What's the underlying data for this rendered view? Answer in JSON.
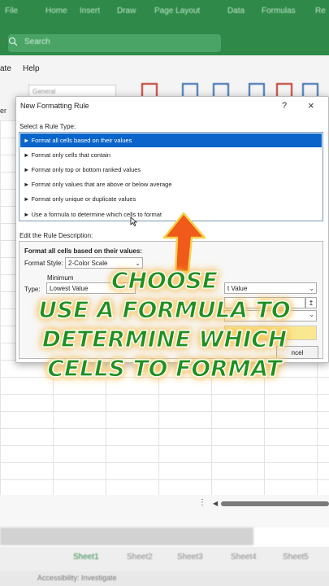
{
  "ribbon": {
    "tabs": [
      "File",
      "Home",
      "Insert",
      "Draw",
      "Page Layout",
      "Data",
      "Formulas",
      "Re"
    ],
    "search_placeholder": "Search"
  },
  "menubar": {
    "items": [
      "ate",
      "Help"
    ],
    "left_fragment": "er"
  },
  "number_format": "General",
  "dialog": {
    "title": "New Formatting Rule",
    "help": "?",
    "close": "×",
    "select_label": "Select a Rule Type:",
    "rules": [
      "► Format all cells based on their values",
      "► Format only cells that contain",
      "► Format only top or bottom ranked values",
      "► Format only values that are above or below average",
      "► Format only unique or duplicate values",
      "► Use a formula to determine which cells to format"
    ],
    "edit_label": "Edit the Rule Description:",
    "desc_heading": "Format all cells based on their values:",
    "format_style_label": "Format Style:",
    "format_style_value": "2-Color Scale",
    "minimum_label": "Minimum",
    "maximum_label": "m",
    "type_label": "Type:",
    "type_min_value": "Lowest Value",
    "type_max_value": "t Value",
    "upload_glyph": "↥",
    "cancel_label": "ncel"
  },
  "caption": {
    "line1": "CHOOSE",
    "line2": "USE A FORMULA TO",
    "line3": "DETERMINE WHICH",
    "line4": "CELLS TO FORMAT"
  },
  "sheets": [
    "Sheet1",
    "Sheet2",
    "Sheet3",
    "Sheet4",
    "Sheet5"
  ],
  "status": "Accessibility: Investigate",
  "colors": {
    "excel_green": "#2f8a4a",
    "selection_blue": "#0a64c9",
    "caption_green": "#1f8f1f",
    "arrow_orange": "#f05a1a",
    "max_color": "#f9e88f"
  }
}
